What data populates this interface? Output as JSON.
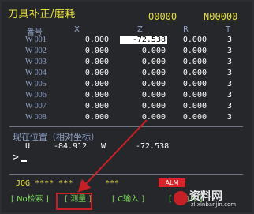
{
  "header": {
    "title": "刀具补正/磨耗",
    "program_o": "O0000",
    "program_n": "N00000"
  },
  "table": {
    "columns": [
      "番号",
      "X",
      "Z",
      "R",
      "T"
    ],
    "rows": [
      {
        "id": "W 001",
        "x": "0.000",
        "z": "-72.538",
        "r": "0.000",
        "t": "3"
      },
      {
        "id": "W 002",
        "x": "0.000",
        "z": "0.000",
        "r": "0.000",
        "t": "3"
      },
      {
        "id": "W 003",
        "x": "0.000",
        "z": "0.000",
        "r": "0.000",
        "t": "3"
      },
      {
        "id": "W 004",
        "x": "0.000",
        "z": "0.000",
        "r": "0.000",
        "t": "3"
      },
      {
        "id": "W 005",
        "x": "0.000",
        "z": "0.000",
        "r": "0.000",
        "t": "3"
      },
      {
        "id": "W 006",
        "x": "0.000",
        "z": "0.000",
        "r": "0.000",
        "t": "3"
      },
      {
        "id": "W 007",
        "x": "0.000",
        "z": "0.000",
        "r": "0.000",
        "t": "3"
      },
      {
        "id": "W 008",
        "x": "0.000",
        "z": "0.000",
        "r": "0.000",
        "t": "3"
      }
    ]
  },
  "position": {
    "title": "现在位置（相对坐标）",
    "u_label": "U",
    "u_value": "-84.912",
    "w_label": "W",
    "w_value": "-72.538"
  },
  "input": {
    "prompt": ">"
  },
  "status": {
    "mode": "JOG **** ***",
    "mode2": "***",
    "alarm": "ALM"
  },
  "softkeys": {
    "k1": "[ No检索 ]",
    "k2": "[ 测量 ]",
    "k3": "[ C输入 ]",
    "k4": "[ +输入 ]"
  },
  "watermark": {
    "text": "资料网",
    "sub": "zl.xinbanjin.com"
  },
  "colors": {
    "accent": "#e6df3f",
    "label": "#8ea0c4",
    "softkey": "#7fdc5a",
    "highlight": "#c42026"
  }
}
